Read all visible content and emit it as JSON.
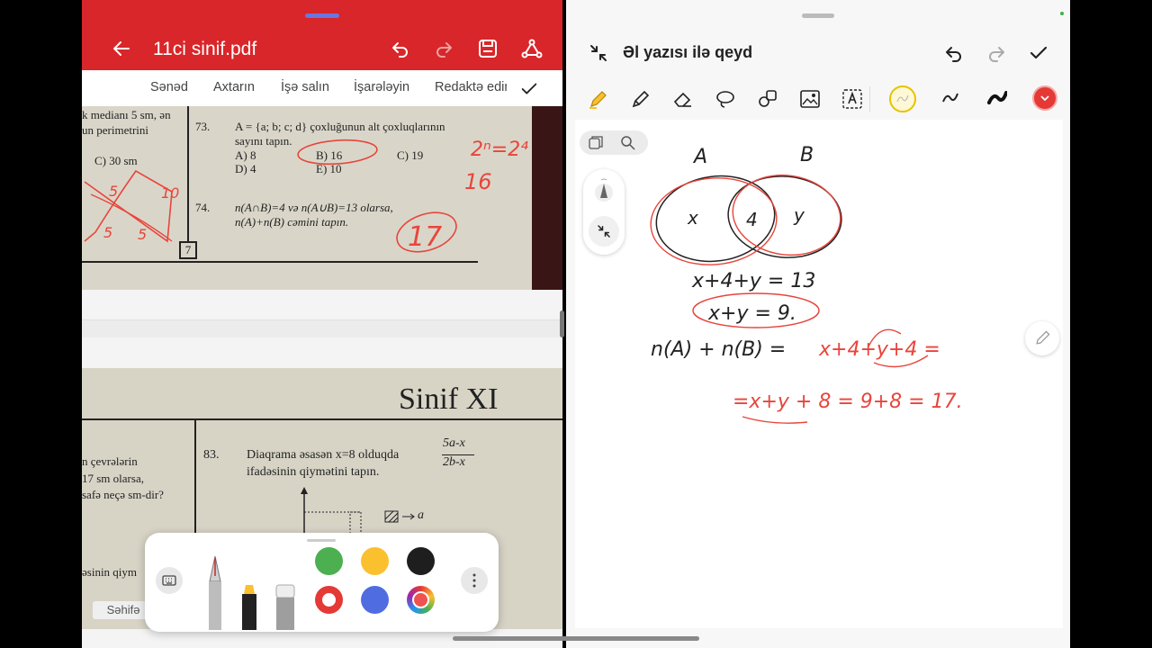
{
  "pdf_viewer": {
    "title": "11ci sinif.pdf",
    "menu": [
      "Sənəd",
      "Axtarın",
      "İşə salın",
      "İşarələyin",
      "Redaktə edin"
    ],
    "page_label": "Səhifə",
    "page1": {
      "left_col": [
        "k medianı 5 sm, ən",
        "un perimetrini",
        "C) 30 sm"
      ],
      "q73_num": "73.",
      "q73_text1": "A = {a; b; c; d} çoxluğunun alt çoxluqlarının",
      "q73_text2": "sayını tapın.",
      "q73_a": "A) 8",
      "q73_b": "B) 16",
      "q73_c": "C) 19",
      "q73_d": "D) 4",
      "q73_e": "E) 10",
      "q74_num": "74.",
      "q74_text1": "n(A∩B)=4 və n(A∪B)=13 olarsa,",
      "q74_text2": "n(A)+n(B) cəmini tapın.",
      "page_number": "7",
      "ink_notes": [
        "2ⁿ=2⁴",
        "16",
        "17",
        "5",
        "10",
        "5",
        "5"
      ]
    },
    "page2": {
      "header": "Sinif  XI",
      "left_col": [
        "n çevrələrin",
        "17 sm olarsa,",
        "safə neçə sm-dir?",
        "əsinin qiym"
      ],
      "q83_num": "83.",
      "q83_text1": "Diaqrama əsasən x=8 olduqda",
      "q83_text2": "ifadəsinin qiymətini tapın.",
      "fraction_num": "5a-x",
      "fraction_den": "2b-x",
      "legend_a": "a"
    },
    "pen_colors": [
      "#4caf50",
      "#fbc02d",
      "#1e1e1e",
      "#e53935",
      "#4f6de0",
      "multicolor"
    ]
  },
  "notes": {
    "title": "Əl yazısı ilə qeyd",
    "handwriting": {
      "label_a": "A",
      "label_b": "B",
      "region_x": "x",
      "region_4": "4",
      "region_y": "y",
      "line1": "x+4+y = 13",
      "line2": "x+y = 9.",
      "line3_black": "n(A) + n(B) =",
      "line3_red": "x+4+y+4 =",
      "line4": "=x+y + 8 = 9+8 = 17."
    }
  }
}
